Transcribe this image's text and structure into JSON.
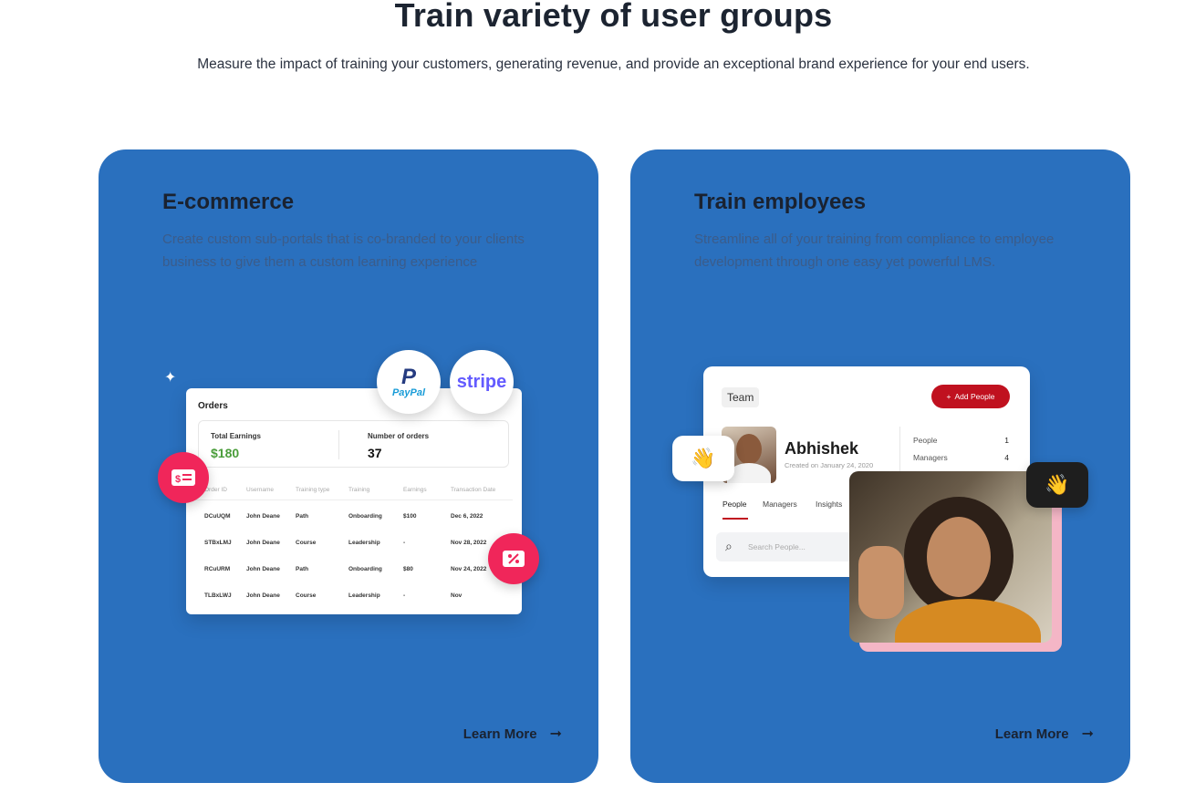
{
  "header": {
    "title": "Train variety of user groups",
    "subtitle": "Measure the impact of training your customers, generating revenue, and provide an exceptional brand experience for your end users."
  },
  "cards": [
    {
      "title": "E-commerce",
      "description": "Create custom sub-portals that is co-branded to your clients business to give them a custom learning experience",
      "learn_more": "Learn More",
      "orders": {
        "title": "Orders",
        "total_earnings_label": "Total Earnings",
        "total_earnings_value": "$180",
        "num_orders_label": "Number of orders",
        "num_orders_value": "37",
        "columns": [
          "Order ID",
          "Username",
          "Training type",
          "Training",
          "Earnings",
          "Transaction Date"
        ],
        "rows": [
          [
            "DCuUQM",
            "John Deane",
            "Path",
            "Onboarding",
            "$100",
            "Dec 6, 2022"
          ],
          [
            "STBxLMJ",
            "John Deane",
            "Course",
            "Leadership",
            "-",
            "Nov 28, 2022"
          ],
          [
            "RCuURM",
            "John Deane",
            "Path",
            "Onboarding",
            "$80",
            "Nov 24, 2022"
          ],
          [
            "TLBxLWJ",
            "John Deane",
            "Course",
            "Leadership",
            "-",
            "Nov"
          ]
        ],
        "paypal_label": "PayPal",
        "stripe_label": "stripe",
        "accent_color": "#f0265a",
        "earnings_color": "#4a9d3a"
      }
    },
    {
      "title": "Train employees",
      "description": "Streamline all of your training from compliance to employee development through one easy yet powerful LMS.",
      "learn_more": "Learn More",
      "team": {
        "tag": "Team",
        "add_button": "Add People",
        "name": "Abhishek",
        "created": "Created on January 24, 2020",
        "counts": [
          {
            "label": "People",
            "value": "1"
          },
          {
            "label": "Managers",
            "value": "4"
          }
        ],
        "tabs": [
          "People",
          "Managers",
          "Insights"
        ],
        "search_placeholder": "Search People...",
        "accent_color": "#c0111f"
      }
    }
  ],
  "card_color": "#2a70be"
}
